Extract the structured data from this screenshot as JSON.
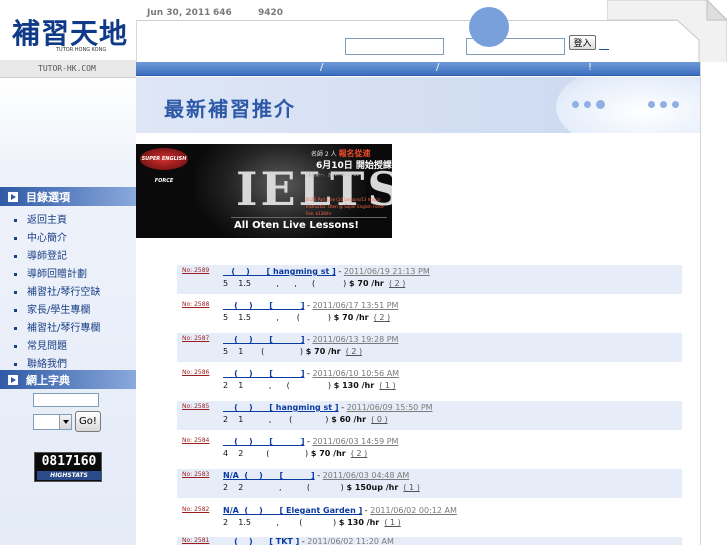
{
  "top_bar": {
    "date": "Jun 30, 2011",
    "count_a": "646",
    "count_b": "9420"
  },
  "logo": {
    "zh": "補習天地",
    "en": "TUTOR HONG KONG",
    "site_url": "TUTOR-HK.COM"
  },
  "login": {
    "username_value": "",
    "password_value": "",
    "button_label": "登入"
  },
  "nav": {
    "separators": [
      "/",
      "/",
      "!"
    ]
  },
  "banner": {
    "title": "最新補習推介"
  },
  "sidebar": {
    "menu_heading": "目錄選項",
    "items": [
      {
        "label": "返回主頁"
      },
      {
        "label": "中心簡介"
      },
      {
        "label": "導師登記"
      },
      {
        "label": "導師回贈計劃"
      },
      {
        "label": "補習社/琴行空缺"
      },
      {
        "label": "家長/學生專欄"
      },
      {
        "label": "補習社/琴行專欄"
      },
      {
        "label": "常見問題"
      },
      {
        "label": "聯絡我們"
      }
    ],
    "dictionary_heading": "網上字典",
    "dictionary_input_value": "",
    "dictionary_go_label": "Go!",
    "counter": {
      "value": "0817160",
      "caption": "HIGHSTATS"
    }
  },
  "ad": {
    "logo_text": "SUPER ENGLISH FORCE",
    "headline": "IELTS",
    "top_note_a": "名師 2 人",
    "top_note_b": "報名從速",
    "date_text": "6月10日 開始授課",
    "detail_a": "(逢星期一、五) 17:00-19:00",
    "detail_b": "IELTS Part One (10 Lessons/13 hours)",
    "detail_c": "Instructor: Oten @ Super English Force",
    "detail_d": "Fee: $128/hr",
    "footer": "All Oten Live Lessons!"
  },
  "listings": [
    {
      "no": "No: 2589",
      "title": "   (    )      [ hangming st ]",
      "when": "2011/06/19 21:13 PM",
      "detail": "5    1.5          ,      ,      (           )",
      "fee": " $ 70 /hr",
      "count": "( 2 )"
    },
    {
      "no": "No: 2588",
      "title": "    (    )      [          ]",
      "when": "2011/06/17 13:51 PM",
      "detail": "5    1.5          ,       (           )",
      "fee": " $ 70 /hr",
      "count": "( 2 )"
    },
    {
      "no": "No: 2587",
      "title": "    (    )      [          ]",
      "when": "2011/06/13 19:28 PM",
      "detail": "5    1       (              )",
      "fee": " $ 70 /hr",
      "count": "( 2 )"
    },
    {
      "no": "No: 2586",
      "title": "    (    )      [          ]",
      "when": "2011/06/10 10:56 AM",
      "detail": "2    1          ,      (               )",
      "fee": " $ 130 /hr",
      "count": "( 1 )"
    },
    {
      "no": "No: 2585",
      "title": "    (    )      [ hangming st ]",
      "when": "2011/06/09 15:50 PM",
      "detail": "2    1          ,       (             )",
      "fee": " $ 60 /hr",
      "count": "( 0 )"
    },
    {
      "no": "No: 2584",
      "title": "    (    )      [          ]",
      "when": "2011/06/03 14:59 PM",
      "detail": "4    2         (              )",
      "fee": " $ 70 /hr",
      "count": "( 2 )"
    },
    {
      "no": "No: 2583",
      "title": "N/A  (    )      [          ]",
      "when": "2011/06/03 04:48 AM",
      "detail": "2    2              ,          (            )",
      "fee": " $ 150up /hr",
      "count": "( 1 )"
    },
    {
      "no": "No: 2582",
      "title": "N/A  (    )      [ Elegant Garden ]",
      "when": "2011/06/02 00:12 AM",
      "detail": "2    1.5          ,        (            )",
      "fee": " $ 130 /hr",
      "count": "( 1 )"
    },
    {
      "no": "No: 2581",
      "title": "    (    )      [ TKT ]",
      "when": "2011/06/02 11:20 AM",
      "detail": "",
      "fee": "",
      "count": ""
    }
  ]
}
